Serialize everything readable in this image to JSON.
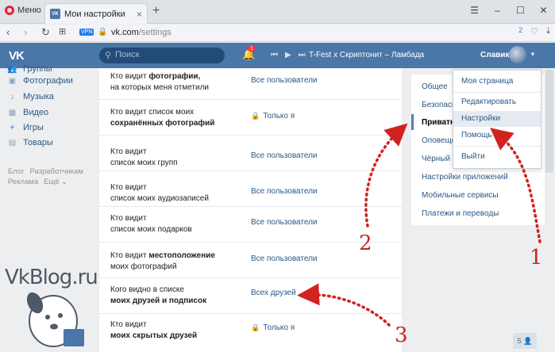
{
  "browser": {
    "menu_label": "Меню",
    "tab_title": "Мои настройки",
    "url_host": "vk.com",
    "url_path": "/settings",
    "vpn_badge": "VPN",
    "addr_count": "2"
  },
  "header": {
    "logo": "VK",
    "search_placeholder": "Поиск",
    "notif_count": "1",
    "track": "T-Fest x Скриптонит – Ламбада",
    "username": "Славик"
  },
  "sidebar": {
    "items": [
      {
        "label": "Группы",
        "icon": "groups-icon"
      },
      {
        "label": "Фотографии",
        "icon": "photos-icon"
      },
      {
        "label": "Музыка",
        "icon": "music-icon"
      },
      {
        "label": "Видео",
        "icon": "video-icon"
      },
      {
        "label": "Игры",
        "icon": "games-icon"
      },
      {
        "label": "Товары",
        "icon": "market-icon"
      }
    ],
    "footer1": [
      "Блог",
      "Разработчикам"
    ],
    "footer2": [
      "Реклама",
      "Ещё"
    ]
  },
  "privacy": [
    {
      "q1": "Кто видит ",
      "qb1": "фотографии,",
      "q2": "на которых меня отметили",
      "value": "Все пользователи",
      "locked": false
    },
    {
      "q1": "Кто видит список моих",
      "qb1": "",
      "q2": "сохранённых фотографий",
      "value": "Только я",
      "locked": true
    },
    {
      "q1": "Кто видит",
      "qb1": "",
      "q2": "список моих групп",
      "value": "Все пользователи",
      "locked": false
    },
    {
      "q1": "Кто видит",
      "qb1": "",
      "q2": "список моих аудиозаписей",
      "value": "Все пользователи",
      "locked": false
    },
    {
      "q1": "Кто видит",
      "qb1": "",
      "q2": "список моих подарков",
      "value": "Все пользователи",
      "locked": false
    },
    {
      "q1": "Кто видит ",
      "qb1": "местоположение",
      "q2": "моих фотографий",
      "value": "Все пользователи",
      "locked": false
    },
    {
      "q1": "Кого видно в списке",
      "qb1": "",
      "q2": "моих друзей и подписок",
      "value": "Всех друзей",
      "locked": false
    },
    {
      "q1": "Кто видит",
      "qb1": "",
      "q2": "моих скрытых друзей",
      "value": "Только я",
      "locked": true
    }
  ],
  "settings_menu": [
    "Общее",
    "Безопасность",
    "Приватность",
    "Оповещения",
    "Чёрный список",
    "Настройки приложений",
    "Мобильные сервисы",
    "Платежи и переводы"
  ],
  "profile_menu": [
    "Моя страница",
    "Редактировать",
    "Настройки",
    "Помощь",
    "Выйти"
  ],
  "corner_count": "5",
  "watermark": "VkBlog.ru",
  "annotations": [
    "1",
    "2",
    "3"
  ],
  "colors": {
    "accent": "#4a76a8",
    "link": "#2a5885",
    "annotation": "#d0231f"
  }
}
